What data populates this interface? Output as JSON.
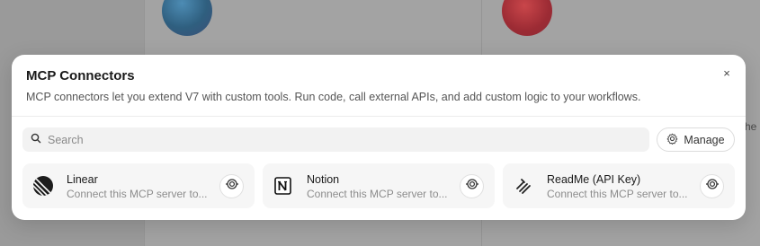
{
  "modal": {
    "title": "MCP Connectors",
    "description": "MCP connectors let you extend V7 with custom tools. Run code, call external APIs, and add custom logic to your workflows.",
    "close_label": "×"
  },
  "search": {
    "placeholder": "Search",
    "value": ""
  },
  "manage_button": {
    "label": "Manage"
  },
  "connectors": [
    {
      "name": "Linear",
      "subtitle": "Connect this MCP server to...",
      "icon": "linear-icon"
    },
    {
      "name": "Notion",
      "subtitle": "Connect this MCP server to...",
      "icon": "notion-icon"
    },
    {
      "name": "ReadMe (API Key)",
      "subtitle": "Connect this MCP server to...",
      "icon": "readme-icon"
    }
  ],
  "background": {
    "partial_text": "he"
  }
}
